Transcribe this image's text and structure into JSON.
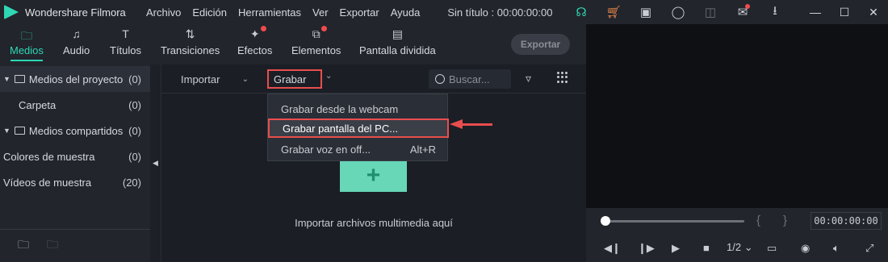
{
  "titlebar": {
    "app_name": "Wondershare Filmora",
    "menu": [
      "Archivo",
      "Edición",
      "Herramientas",
      "Ver",
      "Exportar",
      "Ayuda"
    ],
    "doc_title": "Sin título : 00:00:00:00",
    "window_controls": [
      "—",
      "☐",
      "✕"
    ]
  },
  "tabs": [
    {
      "label": "Medios",
      "icon": "folder-icon",
      "active": true
    },
    {
      "label": "Audio",
      "icon": "music-icon"
    },
    {
      "label": "Títulos",
      "icon": "text-icon"
    },
    {
      "label": "Transiciones",
      "icon": "transition-icon"
    },
    {
      "label": "Efectos",
      "icon": "effects-icon",
      "badge": true
    },
    {
      "label": "Elementos",
      "icon": "elements-icon",
      "badge": true
    },
    {
      "label": "Pantalla dividida",
      "icon": "split-screen-icon"
    }
  ],
  "export_label": "Exportar",
  "sidebar": {
    "items": [
      {
        "label": "Medios del proyecto",
        "count": "(0)"
      },
      {
        "label": "Carpeta",
        "count": "(0)"
      },
      {
        "label": "Medios compartidos",
        "count": "(0)"
      },
      {
        "label": "Colores de muestra",
        "count": "(0)"
      },
      {
        "label": "Vídeos de muestra",
        "count": "(20)"
      }
    ]
  },
  "toolbar": {
    "import_label": "Importar",
    "record_label": "Grabar",
    "search_placeholder": "Buscar..."
  },
  "dropdown": {
    "items": [
      {
        "label": "Grabar desde la webcam",
        "shortcut": ""
      },
      {
        "label": "Grabar pantalla del PC...",
        "shortcut": ""
      },
      {
        "label": "Grabar voz en off...",
        "shortcut": "Alt+R"
      }
    ]
  },
  "import_hint": "Importar archivos multimedia aquí",
  "player": {
    "timecode": "00:00:00:00",
    "speed": "1/2",
    "progress_fraction": 0
  },
  "colors": {
    "accent": "#2fd7b4",
    "highlight": "#e84e4e"
  }
}
